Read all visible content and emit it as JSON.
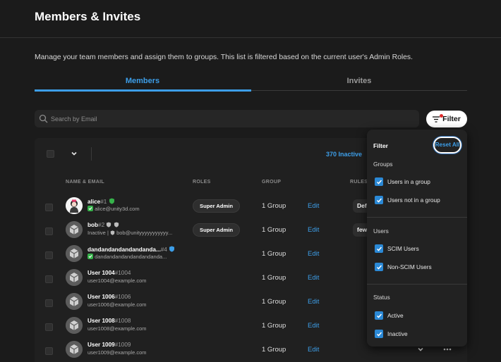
{
  "page": {
    "title": "Members & Invites",
    "description": "Manage your team members and assign them to groups. This list is filtered based on the current user's Admin Roles."
  },
  "tabs": [
    {
      "label": "Members",
      "active": true
    },
    {
      "label": "Invites",
      "active": false
    }
  ],
  "search": {
    "placeholder": "Search by Email",
    "value": ""
  },
  "filter_button": {
    "label": "Filter"
  },
  "table": {
    "inactive_count": "370 Inactive",
    "columns": [
      "NAME & EMAIL",
      "ROLES",
      "GROUP",
      "RULES"
    ],
    "rows": [
      {
        "name": "alice",
        "tag": "#1",
        "email": "alice@unity3d.com",
        "role": "Super Admin",
        "group": "1 Group",
        "edit": "Edit",
        "rule": "Def"
      },
      {
        "name": "bob",
        "tag": "#2",
        "email": "bob@unityyyyyyyyyyy...",
        "status": "Inactive",
        "role": "Super Admin",
        "group": "1 Group",
        "edit": "Edit",
        "rule": "few"
      },
      {
        "name": "dandandandandandanda...",
        "tag": "#4",
        "email": "dandandandandandandanda...",
        "role": "",
        "group": "1 Group",
        "edit": "Edit",
        "rule": ""
      },
      {
        "name": "User 1004",
        "tag": "#1004",
        "email": "user1004@example.com",
        "role": "",
        "group": "1 Group",
        "edit": "Edit",
        "rule": ""
      },
      {
        "name": "User 1006",
        "tag": "#1006",
        "email": "user1006@example.com",
        "role": "",
        "group": "1 Group",
        "edit": "Edit",
        "rule": ""
      },
      {
        "name": "User 1008",
        "tag": "#1008",
        "email": "user1008@example.com",
        "role": "",
        "group": "1 Group",
        "edit": "Edit",
        "rule": ""
      },
      {
        "name": "User 1009",
        "tag": "#1009",
        "email": "user1009@example.com",
        "role": "",
        "group": "1 Group",
        "edit": "Edit",
        "rule": ""
      }
    ]
  },
  "filter_panel": {
    "title": "Filter",
    "reset_label": "Reset All",
    "sections": [
      {
        "title": "Groups",
        "options": [
          {
            "label": "Users in a group",
            "checked": true
          },
          {
            "label": "Users not in a group",
            "checked": true
          }
        ]
      },
      {
        "title": "Users",
        "options": [
          {
            "label": "SCIM Users",
            "checked": true
          },
          {
            "label": "Non-SCIM Users",
            "checked": true
          }
        ]
      },
      {
        "title": "Status",
        "options": [
          {
            "label": "Active",
            "checked": true
          },
          {
            "label": "Inactive",
            "checked": true
          }
        ]
      }
    ]
  },
  "colors": {
    "accent": "#3d9ee8",
    "background": "#1b1b1b",
    "badge_green": "#36b24a",
    "notify_red": "#e02b2b"
  }
}
